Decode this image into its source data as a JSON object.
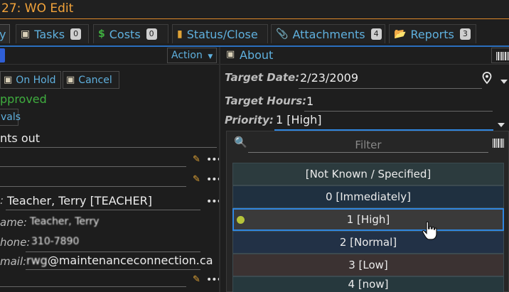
{
  "window": {
    "title": "27: WO Edit"
  },
  "tabs": [
    {
      "label": "y"
    },
    {
      "label": "Tasks",
      "badge": "0"
    },
    {
      "label": "Costs",
      "badge": "0"
    },
    {
      "label": "Status/Close"
    },
    {
      "label": "Attachments",
      "badge": "4"
    },
    {
      "label": "Reports",
      "badge": "3"
    }
  ],
  "left": {
    "action_label": "Action",
    "on_hold_label": "On Hold",
    "cancel_label": "Cancel",
    "status_text": "pproved",
    "approvals_label": "vals",
    "description": "nts out",
    "requester_label": ":",
    "requester_value": "Teacher, Terry [TEACHER]",
    "name_label": "ame:",
    "name_value": "Teacher, Terry",
    "phone_label": "hone:",
    "phone_value": "310-7890",
    "email_label": "mail:",
    "email_user": "rwg",
    "email_domain": "@maintenanceconnection.ca"
  },
  "about": {
    "title": "About",
    "target_date_label": "Target Date:",
    "target_date_value": "2/23/2009",
    "target_hours_label": "Target Hours:",
    "target_hours_value": "1",
    "priority_label": "Priority:",
    "priority_value": "1 [High]"
  },
  "dropdown": {
    "filter_placeholder": "Filter",
    "options": [
      "[Not Known / Specified]",
      "0 [Immediately]",
      "1 [High]",
      "2 [Normal]",
      "3 [Low]",
      "4 [now]"
    ],
    "selected_index": 2
  },
  "colors": {
    "accent": "#5fb0de",
    "title_orange": "#f2a33a",
    "status_green": "#3fae3f",
    "selection_border": "#2f86e0"
  }
}
